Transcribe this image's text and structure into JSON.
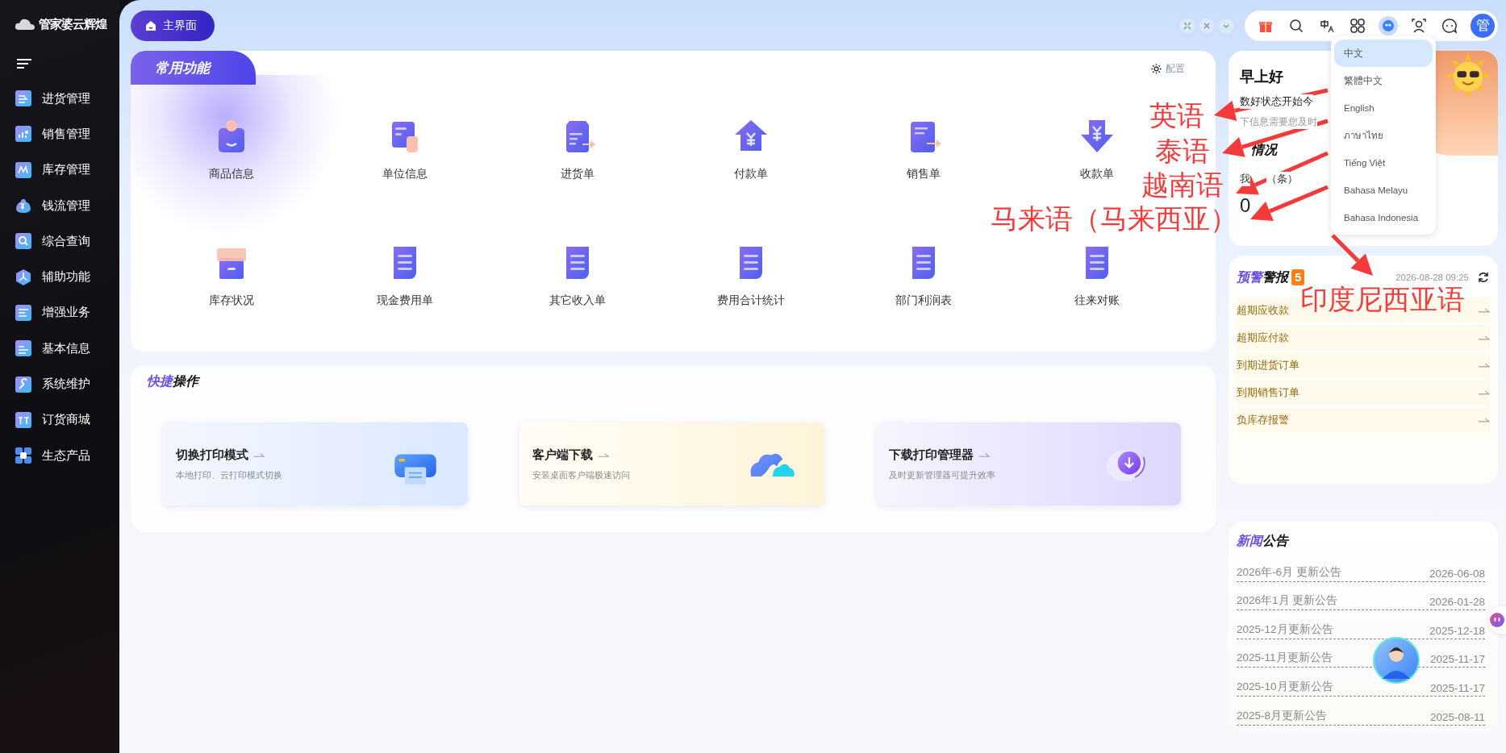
{
  "sidebar": {
    "logo": "管家婆云辉煌",
    "items": [
      {
        "label": "进货管理"
      },
      {
        "label": "销售管理"
      },
      {
        "label": "库存管理"
      },
      {
        "label": "钱流管理"
      },
      {
        "label": "综合查询"
      },
      {
        "label": "辅助功能"
      },
      {
        "label": "增强业务"
      },
      {
        "label": "基本信息"
      },
      {
        "label": "系统维护"
      },
      {
        "label": "订货商城"
      },
      {
        "label": "生态产品"
      }
    ]
  },
  "header": {
    "home_button": "主界面",
    "avatar": "管",
    "language_menu": [
      {
        "label": "中文",
        "selected": true
      },
      {
        "label": "繁體中文",
        "selected": false
      },
      {
        "label": "English",
        "selected": false
      },
      {
        "label": "ภาษาไทย",
        "selected": false
      },
      {
        "label": "Tiếng Việt",
        "selected": false
      },
      {
        "label": "Bahasa Melayu",
        "selected": false
      },
      {
        "label": "Bahasa Indonesia",
        "selected": false
      }
    ]
  },
  "common_functions": {
    "title": "常用功能",
    "config_link": "配置",
    "items": [
      {
        "label": "商品信息"
      },
      {
        "label": "单位信息"
      },
      {
        "label": "进货单"
      },
      {
        "label": "付款单"
      },
      {
        "label": "销售单"
      },
      {
        "label": "收款单"
      },
      {
        "label": "库存状况"
      },
      {
        "label": "现金费用单"
      },
      {
        "label": "其它收入单"
      },
      {
        "label": "费用合计统计"
      },
      {
        "label": "部门利润表"
      },
      {
        "label": "往来对账"
      }
    ]
  },
  "quick_actions": {
    "title_accent": "快捷",
    "title_rest": "操作",
    "cards": [
      {
        "title": "切换打印模式",
        "subtitle": "本地打印、云打印模式切换"
      },
      {
        "title": "客户端下载",
        "subtitle": "安装桌面客户端极速访问"
      },
      {
        "title": "下载打印管理器",
        "subtitle": "及时更新管理器可提升效率"
      }
    ]
  },
  "greeting": {
    "title": "早上好",
    "line_1": "数好状态开始今",
    "line_2": "下信息需要您及时",
    "section_title": "情况",
    "stat_label_start": "我",
    "stat_label_end": "（条）",
    "stat_value": "0"
  },
  "alerts": {
    "title_accent": "预警",
    "title_rest": "警报",
    "badge": "5",
    "timestamp": "2026-08-28 09:25",
    "items": [
      {
        "label": "超期应收款"
      },
      {
        "label": "超期应付款"
      },
      {
        "label": "到期进货订单"
      },
      {
        "label": "到期销售订单"
      },
      {
        "label": "负库存报警"
      }
    ]
  },
  "news": {
    "title_accent": "新闻",
    "title_rest": "公告",
    "items": [
      {
        "title": "2026年-6月 更新公告",
        "date": "2026-06-08"
      },
      {
        "title": "2026年1月 更新公告",
        "date": "2026-01-28"
      },
      {
        "title": "2025-12月更新公告",
        "date": "2025-12-18"
      },
      {
        "title": "2025-11月更新公告",
        "date": "2025-11-17"
      },
      {
        "title": "2025-10月更新公告",
        "date": "2025-11-17"
      },
      {
        "title": "2025-8月更新公告",
        "date": "2025-08-11"
      }
    ]
  },
  "annotations": [
    {
      "text": "英语"
    },
    {
      "text": "泰语"
    },
    {
      "text": "越南语"
    },
    {
      "text": "马来语（马来西亚）"
    },
    {
      "text": "印度尼西亚语"
    }
  ]
}
